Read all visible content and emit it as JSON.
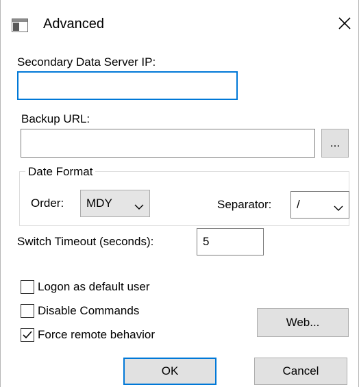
{
  "window": {
    "title": "Advanced",
    "icon": "window-app-icon",
    "close_icon": "close-icon"
  },
  "secondary_ip": {
    "label": "Secondary Data Server IP:",
    "value": ""
  },
  "backup_url": {
    "label": "Backup URL:",
    "value": "",
    "browse_label": "..."
  },
  "date_format": {
    "legend": "Date Format",
    "order_label": "Order:",
    "order_value": "MDY",
    "separator_label": "Separator:",
    "separator_value": "/"
  },
  "switch_timeout": {
    "label": "Switch Timeout (seconds):",
    "value": "5"
  },
  "options": [
    {
      "label": "Logon as default user",
      "checked": false
    },
    {
      "label": "Disable Commands",
      "checked": false
    },
    {
      "label": "Force remote behavior",
      "checked": true
    }
  ],
  "buttons": {
    "web": "Web...",
    "ok": "OK",
    "cancel": "Cancel"
  },
  "colors": {
    "accent": "#0078d7",
    "button_face": "#e1e1e1"
  }
}
